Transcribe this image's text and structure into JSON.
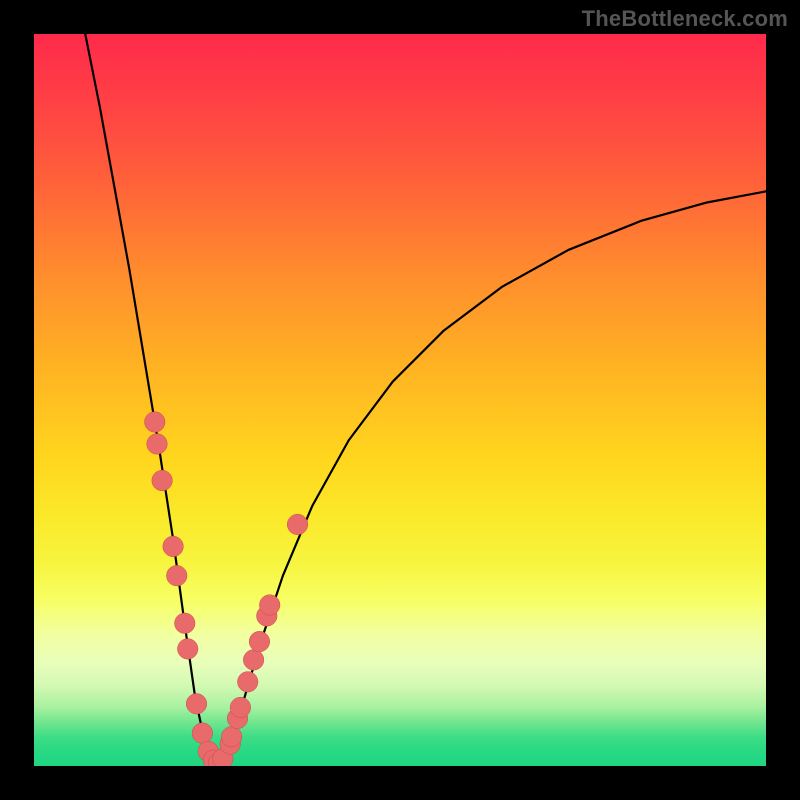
{
  "watermark": "TheBottleneck.com",
  "colors": {
    "bg_black": "#000000",
    "watermark_gray": "#555555",
    "curve_stroke": "#000000",
    "marker_fill": "#e96a6a",
    "marker_stroke": "#c94a4a"
  },
  "chart_data": {
    "type": "line",
    "title": "",
    "xlabel": "",
    "ylabel": "",
    "xlim": [
      0,
      1
    ],
    "ylim": [
      0,
      1
    ],
    "grid": false,
    "legend": "none",
    "comment": "Axes unlabeled in screenshot; values normalized 0–1. Curve is a V-shaped dip: steep descent from (~0.07,1.0) to minimum near x≈0.24, y≈0, then rising concave to (~1.0,0.78). Markers cluster along both walls of the dip near the bottom.",
    "series": [
      {
        "name": "curve",
        "x": [
          0.07,
          0.09,
          0.11,
          0.13,
          0.15,
          0.17,
          0.19,
          0.205,
          0.22,
          0.235,
          0.25,
          0.265,
          0.285,
          0.31,
          0.34,
          0.38,
          0.43,
          0.49,
          0.56,
          0.64,
          0.73,
          0.83,
          0.92,
          1.0
        ],
        "values": [
          1.0,
          0.9,
          0.79,
          0.68,
          0.56,
          0.44,
          0.31,
          0.2,
          0.095,
          0.025,
          0.0,
          0.025,
          0.085,
          0.17,
          0.26,
          0.355,
          0.445,
          0.525,
          0.595,
          0.655,
          0.705,
          0.745,
          0.77,
          0.785
        ]
      }
    ],
    "markers": {
      "name": "points",
      "fill": "#e96a6a",
      "r_fraction": 0.014,
      "xy": [
        [
          0.165,
          0.47
        ],
        [
          0.168,
          0.44
        ],
        [
          0.175,
          0.39
        ],
        [
          0.19,
          0.3
        ],
        [
          0.195,
          0.26
        ],
        [
          0.206,
          0.195
        ],
        [
          0.21,
          0.16
        ],
        [
          0.222,
          0.085
        ],
        [
          0.23,
          0.045
        ],
        [
          0.238,
          0.02
        ],
        [
          0.245,
          0.008
        ],
        [
          0.252,
          0.004
        ],
        [
          0.258,
          0.01
        ],
        [
          0.268,
          0.03
        ],
        [
          0.27,
          0.04
        ],
        [
          0.278,
          0.065
        ],
        [
          0.282,
          0.08
        ],
        [
          0.292,
          0.115
        ],
        [
          0.3,
          0.145
        ],
        [
          0.308,
          0.17
        ],
        [
          0.318,
          0.205
        ],
        [
          0.322,
          0.22
        ],
        [
          0.36,
          0.33
        ]
      ]
    }
  }
}
